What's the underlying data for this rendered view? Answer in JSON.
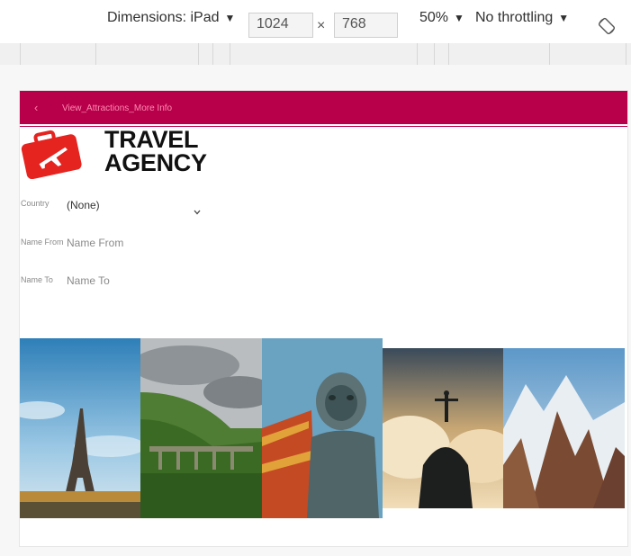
{
  "devtools": {
    "dimensions_label": "Dimensions: iPad",
    "width_value": "1024",
    "times_symbol": "×",
    "height_value": "768",
    "zoom_label": "50%",
    "throttle_label": "No throttling",
    "caret": "▼",
    "rotate_icon": "rotate-icon"
  },
  "app": {
    "header": {
      "back_icon": "chevron-left-icon",
      "back_glyph": "‹",
      "title": "View_Attractions_More Info",
      "color": "#b8004a"
    },
    "logo": {
      "line1": "TRAVEL",
      "line2": "AGENCY",
      "icon": "suitcase-airplane-icon",
      "icon_color": "#e52420"
    },
    "form": {
      "country_label": "Country",
      "country_value": "(None)",
      "name_from_label": "Name From",
      "name_from_placeholder": "Name From",
      "name_to_label": "Name To",
      "name_to_placeholder": "Name To"
    },
    "gallery": [
      {
        "name": "eiffel-tower-image"
      },
      {
        "name": "green-valley-viaduct-image"
      },
      {
        "name": "chinese-lion-statue-image"
      },
      {
        "name": "christ-redeemer-clouds-image"
      },
      {
        "name": "snowy-mountains-image"
      }
    ]
  }
}
